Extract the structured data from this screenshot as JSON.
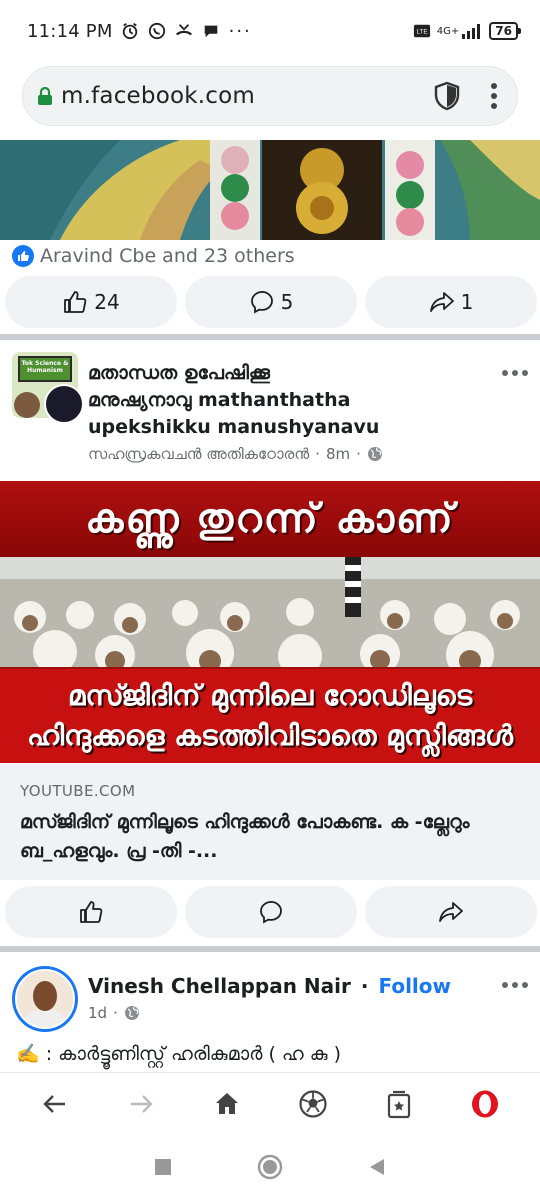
{
  "status_bar": {
    "time": "11:14 PM",
    "network": "4G+",
    "battery": "76"
  },
  "browser": {
    "url": "m.facebook.com"
  },
  "post1": {
    "reactions_text": "Aravind Cbe and 23 others",
    "like_count": "24",
    "comment_count": "5",
    "share_count": "1"
  },
  "post2": {
    "group_avatar_text": "Tok Science & Humanism",
    "title_line1": "മതാന്ധത ഉപേഷിക്കൂ",
    "title_line2": "മനുഷ്യനാവു mathanthatha",
    "title_line3": "upekshikku manushyanavu",
    "author": "സഹസ്രകവചൻ അതികഠോരൻ",
    "time": "8m",
    "thumbnail_headline": "കണ്ണു തുറന്ന് കാണ്",
    "thumbnail_line1": "മസ്ജിദിന് മുന്നിലെ റോഡിലൂടെ",
    "thumbnail_line2": "ഹിന്ദുക്കളെ  കടത്തിവിടാതെ മുസ്ലിങ്ങൾ",
    "link_domain": "YOUTUBE.COM",
    "link_title": "മസ്ജിദിന് മുന്നിലൂടെ ഹിന്ദുക്കൾ പോകണ്ട. ക -ല്ലേറും ബ_ഹളവും. പ്ര -തി -..."
  },
  "post3": {
    "author": "Vinesh Chellappan Nair",
    "follow_label": "Follow",
    "time": "1d",
    "text": "✍️ : കാർട്ടൂണിസ്റ്റ് ഹരികുമാർ ( ഹ കു )"
  },
  "colors": {
    "accent": "#1877f2",
    "muted": "#65676b",
    "button_bg": "#f0f2f5",
    "divider": "#c9ccd1",
    "opera_red": "#e0141e"
  }
}
